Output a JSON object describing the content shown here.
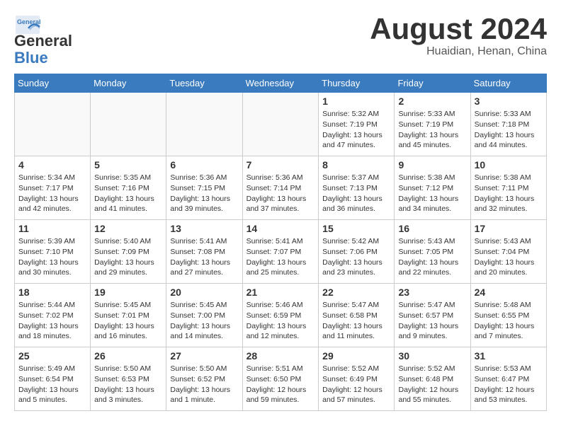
{
  "header": {
    "logo_general": "General",
    "logo_blue": "Blue",
    "month_title": "August 2024",
    "location": "Huaidian, Henan, China"
  },
  "weekdays": [
    "Sunday",
    "Monday",
    "Tuesday",
    "Wednesday",
    "Thursday",
    "Friday",
    "Saturday"
  ],
  "weeks": [
    [
      {
        "day": "",
        "info": ""
      },
      {
        "day": "",
        "info": ""
      },
      {
        "day": "",
        "info": ""
      },
      {
        "day": "",
        "info": ""
      },
      {
        "day": "1",
        "info": "Sunrise: 5:32 AM\nSunset: 7:19 PM\nDaylight: 13 hours\nand 47 minutes."
      },
      {
        "day": "2",
        "info": "Sunrise: 5:33 AM\nSunset: 7:19 PM\nDaylight: 13 hours\nand 45 minutes."
      },
      {
        "day": "3",
        "info": "Sunrise: 5:33 AM\nSunset: 7:18 PM\nDaylight: 13 hours\nand 44 minutes."
      }
    ],
    [
      {
        "day": "4",
        "info": "Sunrise: 5:34 AM\nSunset: 7:17 PM\nDaylight: 13 hours\nand 42 minutes."
      },
      {
        "day": "5",
        "info": "Sunrise: 5:35 AM\nSunset: 7:16 PM\nDaylight: 13 hours\nand 41 minutes."
      },
      {
        "day": "6",
        "info": "Sunrise: 5:36 AM\nSunset: 7:15 PM\nDaylight: 13 hours\nand 39 minutes."
      },
      {
        "day": "7",
        "info": "Sunrise: 5:36 AM\nSunset: 7:14 PM\nDaylight: 13 hours\nand 37 minutes."
      },
      {
        "day": "8",
        "info": "Sunrise: 5:37 AM\nSunset: 7:13 PM\nDaylight: 13 hours\nand 36 minutes."
      },
      {
        "day": "9",
        "info": "Sunrise: 5:38 AM\nSunset: 7:12 PM\nDaylight: 13 hours\nand 34 minutes."
      },
      {
        "day": "10",
        "info": "Sunrise: 5:38 AM\nSunset: 7:11 PM\nDaylight: 13 hours\nand 32 minutes."
      }
    ],
    [
      {
        "day": "11",
        "info": "Sunrise: 5:39 AM\nSunset: 7:10 PM\nDaylight: 13 hours\nand 30 minutes."
      },
      {
        "day": "12",
        "info": "Sunrise: 5:40 AM\nSunset: 7:09 PM\nDaylight: 13 hours\nand 29 minutes."
      },
      {
        "day": "13",
        "info": "Sunrise: 5:41 AM\nSunset: 7:08 PM\nDaylight: 13 hours\nand 27 minutes."
      },
      {
        "day": "14",
        "info": "Sunrise: 5:41 AM\nSunset: 7:07 PM\nDaylight: 13 hours\nand 25 minutes."
      },
      {
        "day": "15",
        "info": "Sunrise: 5:42 AM\nSunset: 7:06 PM\nDaylight: 13 hours\nand 23 minutes."
      },
      {
        "day": "16",
        "info": "Sunrise: 5:43 AM\nSunset: 7:05 PM\nDaylight: 13 hours\nand 22 minutes."
      },
      {
        "day": "17",
        "info": "Sunrise: 5:43 AM\nSunset: 7:04 PM\nDaylight: 13 hours\nand 20 minutes."
      }
    ],
    [
      {
        "day": "18",
        "info": "Sunrise: 5:44 AM\nSunset: 7:02 PM\nDaylight: 13 hours\nand 18 minutes."
      },
      {
        "day": "19",
        "info": "Sunrise: 5:45 AM\nSunset: 7:01 PM\nDaylight: 13 hours\nand 16 minutes."
      },
      {
        "day": "20",
        "info": "Sunrise: 5:45 AM\nSunset: 7:00 PM\nDaylight: 13 hours\nand 14 minutes."
      },
      {
        "day": "21",
        "info": "Sunrise: 5:46 AM\nSunset: 6:59 PM\nDaylight: 13 hours\nand 12 minutes."
      },
      {
        "day": "22",
        "info": "Sunrise: 5:47 AM\nSunset: 6:58 PM\nDaylight: 13 hours\nand 11 minutes."
      },
      {
        "day": "23",
        "info": "Sunrise: 5:47 AM\nSunset: 6:57 PM\nDaylight: 13 hours\nand 9 minutes."
      },
      {
        "day": "24",
        "info": "Sunrise: 5:48 AM\nSunset: 6:55 PM\nDaylight: 13 hours\nand 7 minutes."
      }
    ],
    [
      {
        "day": "25",
        "info": "Sunrise: 5:49 AM\nSunset: 6:54 PM\nDaylight: 13 hours\nand 5 minutes."
      },
      {
        "day": "26",
        "info": "Sunrise: 5:50 AM\nSunset: 6:53 PM\nDaylight: 13 hours\nand 3 minutes."
      },
      {
        "day": "27",
        "info": "Sunrise: 5:50 AM\nSunset: 6:52 PM\nDaylight: 13 hours\nand 1 minute."
      },
      {
        "day": "28",
        "info": "Sunrise: 5:51 AM\nSunset: 6:50 PM\nDaylight: 12 hours\nand 59 minutes."
      },
      {
        "day": "29",
        "info": "Sunrise: 5:52 AM\nSunset: 6:49 PM\nDaylight: 12 hours\nand 57 minutes."
      },
      {
        "day": "30",
        "info": "Sunrise: 5:52 AM\nSunset: 6:48 PM\nDaylight: 12 hours\nand 55 minutes."
      },
      {
        "day": "31",
        "info": "Sunrise: 5:53 AM\nSunset: 6:47 PM\nDaylight: 12 hours\nand 53 minutes."
      }
    ]
  ]
}
